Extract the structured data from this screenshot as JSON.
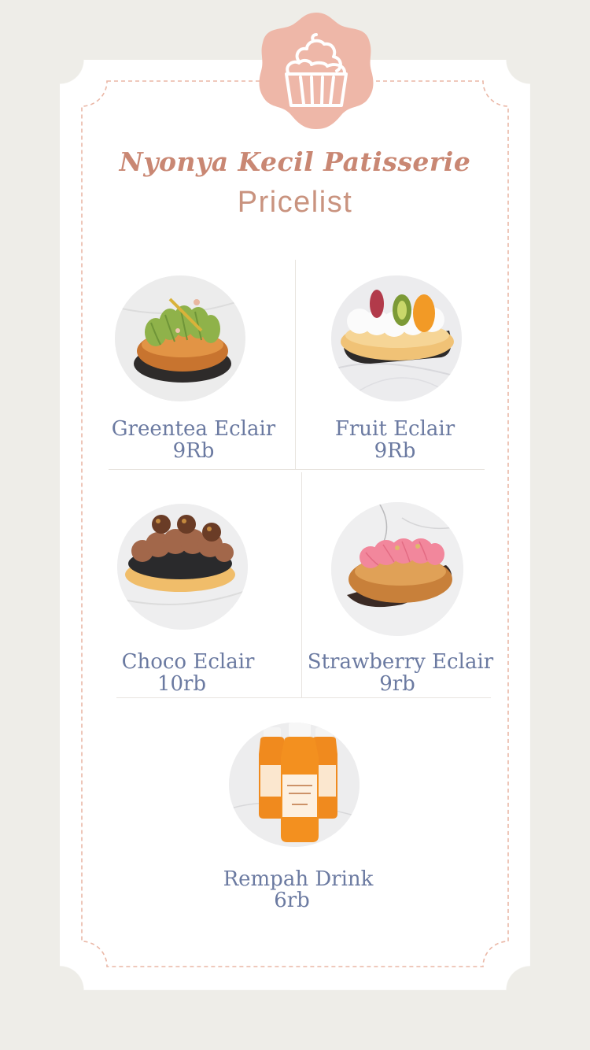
{
  "header": {
    "brand": "Nyonya Kecil Patisserie",
    "subtitle": "Pricelist",
    "badge_icon": "cupcake-icon"
  },
  "colors": {
    "background": "#eeede8",
    "card": "#ffffff",
    "accent_pink": "#eeb7a8",
    "brand_text": "#c98773",
    "item_text": "#6b7aa1",
    "dashed_border": "#eab7a6"
  },
  "menu": [
    {
      "name": "Greentea Eclair",
      "price": "9Rb"
    },
    {
      "name": "Fruit Eclair",
      "price": "9Rb"
    },
    {
      "name": "Choco Eclair",
      "price": "10rb"
    },
    {
      "name": "Strawberry Eclair",
      "price": "9rb"
    },
    {
      "name": "Rempah Drink",
      "price": "6rb"
    }
  ]
}
